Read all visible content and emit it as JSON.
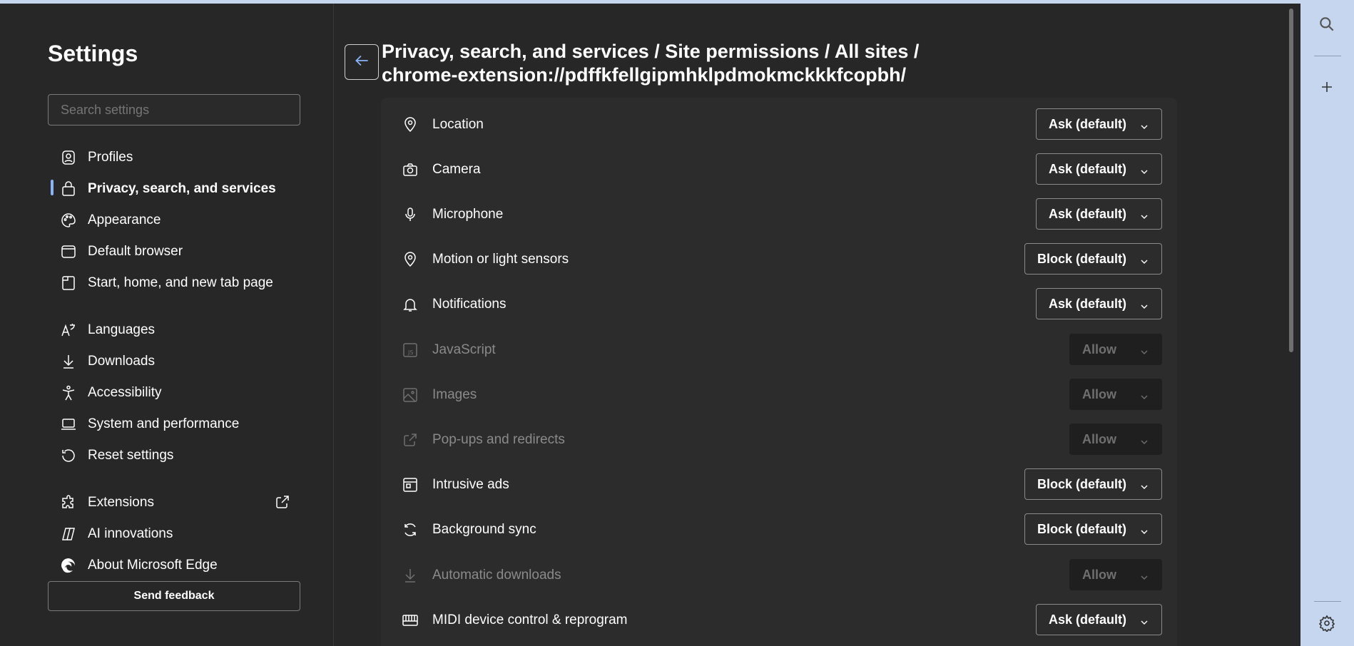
{
  "nav": {
    "title": "Settings",
    "search_placeholder": "Search settings",
    "items": [
      {
        "label": "Profiles",
        "icon": "profile-icon"
      },
      {
        "label": "Privacy, search, and services",
        "icon": "lock-icon",
        "active": true
      },
      {
        "label": "Appearance",
        "icon": "palette-icon"
      },
      {
        "label": "Default browser",
        "icon": "browser-icon"
      },
      {
        "label": "Start, home, and new tab page",
        "icon": "home-tab-icon"
      },
      {
        "label": "Languages",
        "icon": "languages-icon"
      },
      {
        "label": "Downloads",
        "icon": "download-icon"
      },
      {
        "label": "Accessibility",
        "icon": "accessibility-icon"
      },
      {
        "label": "System and performance",
        "icon": "laptop-icon"
      },
      {
        "label": "Reset settings",
        "icon": "reset-icon"
      },
      {
        "label": "Extensions",
        "icon": "puzzle-icon"
      },
      {
        "label": "AI innovations",
        "icon": "copilot-icon"
      },
      {
        "label": "About Microsoft Edge",
        "icon": "edge-icon"
      }
    ],
    "feedback_label": "Send feedback"
  },
  "main": {
    "breadcrumb_line1": "Privacy, search, and services / Site permissions / All sites /",
    "breadcrumb_line2": "chrome-extension://pdffkfellgipmhklpdmokmckkkfcopbh/",
    "permissions": [
      {
        "label": "Location",
        "value": "Ask (default)",
        "icon": "location-icon",
        "enabled": true
      },
      {
        "label": "Camera",
        "value": "Ask (default)",
        "icon": "camera-icon",
        "enabled": true
      },
      {
        "label": "Microphone",
        "value": "Ask (default)",
        "icon": "microphone-icon",
        "enabled": true
      },
      {
        "label": "Motion or light sensors",
        "value": "Block (default)",
        "icon": "sensor-icon",
        "enabled": true
      },
      {
        "label": "Notifications",
        "value": "Ask (default)",
        "icon": "bell-icon",
        "enabled": true
      },
      {
        "label": "JavaScript",
        "value": "Allow",
        "icon": "javascript-icon",
        "enabled": false
      },
      {
        "label": "Images",
        "value": "Allow",
        "icon": "image-icon",
        "enabled": false
      },
      {
        "label": "Pop-ups and redirects",
        "value": "Allow",
        "icon": "popup-icon",
        "enabled": false
      },
      {
        "label": "Intrusive ads",
        "value": "Block (default)",
        "icon": "ads-icon",
        "enabled": true
      },
      {
        "label": "Background sync",
        "value": "Block (default)",
        "icon": "sync-icon",
        "enabled": true
      },
      {
        "label": "Automatic downloads",
        "value": "Allow",
        "icon": "download-icon",
        "enabled": false
      },
      {
        "label": "MIDI device control & reprogram",
        "value": "Ask (default)",
        "icon": "midi-icon",
        "enabled": true
      }
    ]
  },
  "rail": {
    "buttons": [
      "search-icon",
      "add-icon",
      "gear-icon"
    ]
  },
  "colors": {
    "background": "#272727",
    "panel": "#2c2c2c",
    "accent": "#8ab4f8",
    "rail": "#c5d6ee"
  }
}
